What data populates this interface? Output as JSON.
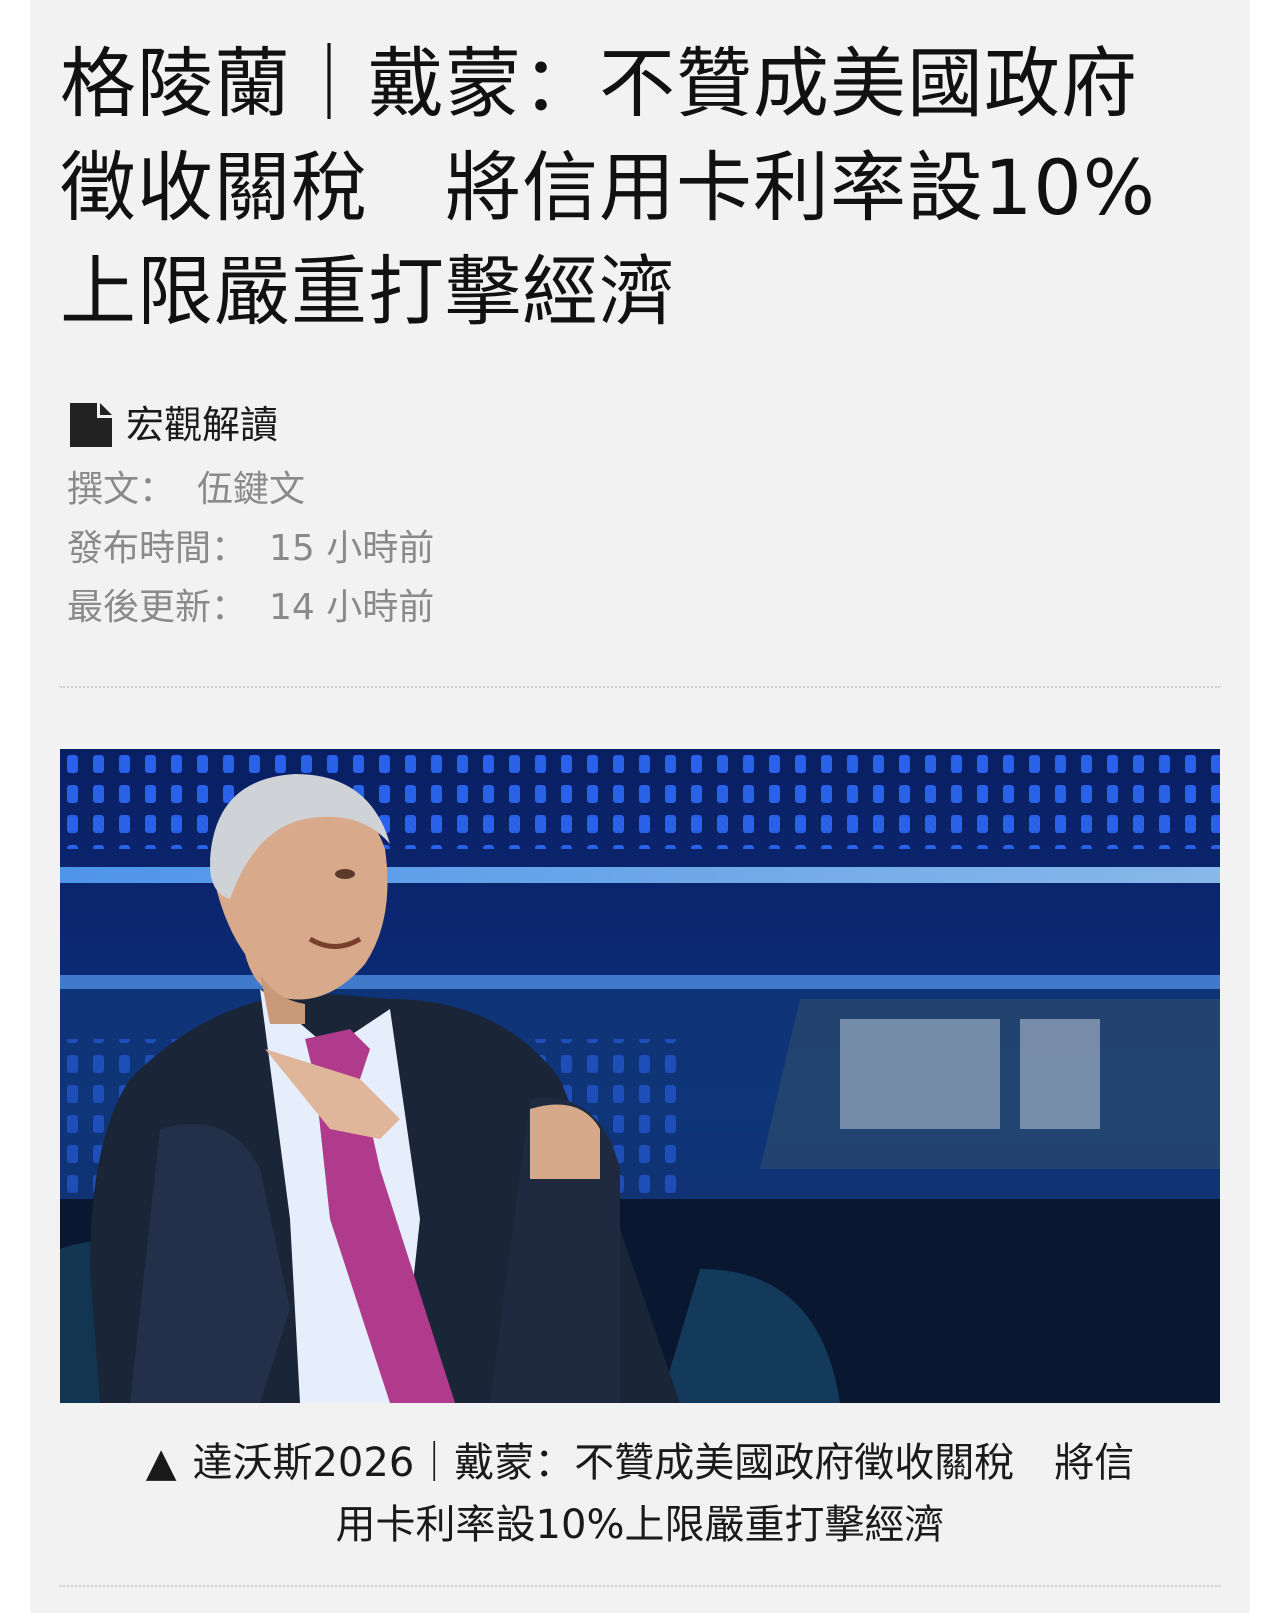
{
  "article": {
    "headline_lines": [
      "格陵蘭｜戴蒙：不贊成美國政府",
      "徵收關稅　將信用卡利率設10%",
      "上限嚴重打擊經濟"
    ],
    "category": "宏觀解讀",
    "category_icon": "document-icon",
    "author_label": "撰文：",
    "author": "伍鍵文",
    "published_label": "發布時間：",
    "published": "15 小時前",
    "updated_label": "最後更新：",
    "updated": "14 小時前"
  },
  "photo": {
    "caption_marker": "▲",
    "caption_line1": "達沃斯2026｜戴蒙：不贊成美國政府徵收關稅　將信",
    "caption_line2": "用卡利率設10%上限嚴重打擊經濟"
  },
  "colors": {
    "card_bg": "#f2f2f2",
    "meta_text": "#8a8a8a",
    "tie": "#b03a8c",
    "backdrop": "#0b2a6e"
  }
}
